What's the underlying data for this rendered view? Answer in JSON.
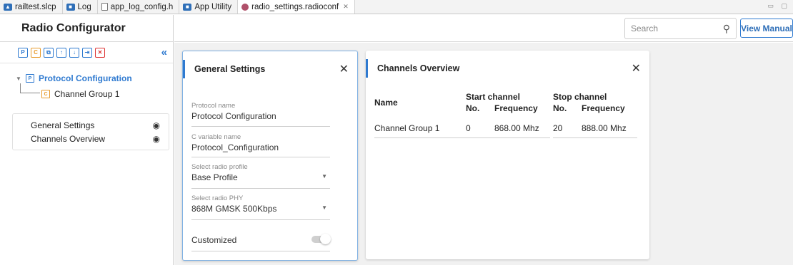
{
  "tabs": [
    {
      "label": "railtest.slcp",
      "icon": "project-icon"
    },
    {
      "label": "Log",
      "icon": "log-icon"
    },
    {
      "label": "app_log_config.h",
      "icon": "header-file-icon"
    },
    {
      "label": "App Utility",
      "icon": "app-utility-icon"
    },
    {
      "label": "radio_settings.radioconf",
      "icon": "radio-icon",
      "active": true
    }
  ],
  "left_panel": {
    "title": "Radio Configurator",
    "tree": {
      "root": {
        "badge": "P",
        "label": "Protocol Configuration"
      },
      "child": {
        "badge": "C",
        "label": "Channel Group 1"
      }
    },
    "views": [
      {
        "label": "General Settings"
      },
      {
        "label": "Channels Overview"
      }
    ]
  },
  "header": {
    "search_placeholder": "Search",
    "view_manual": "View Manual"
  },
  "general_settings": {
    "title": "General Settings",
    "fields": {
      "protocol_name": {
        "label": "Protocol name",
        "value": "Protocol Configuration"
      },
      "c_variable": {
        "label": "C variable name",
        "value": "Protocol_Configuration"
      },
      "radio_profile": {
        "label": "Select radio profile",
        "value": "Base Profile"
      },
      "radio_phy": {
        "label": "Select radio PHY",
        "value": "868M GMSK 500Kbps"
      },
      "customized": {
        "label": "Customized",
        "on": false
      }
    }
  },
  "channels_overview": {
    "title": "Channels Overview",
    "headers": {
      "name": "Name",
      "start": "Start channel",
      "stop": "Stop channel",
      "no": "No.",
      "frequency": "Frequency"
    },
    "rows": [
      {
        "name": "Channel Group 1",
        "start_no": "0",
        "start_freq": "868.00 Mhz",
        "stop_no": "20",
        "stop_freq": "888.00 Mhz"
      }
    ]
  },
  "colors": {
    "accent": "#2f7ad0",
    "config_badge": "#e79a2b",
    "delete": "#d33333"
  }
}
